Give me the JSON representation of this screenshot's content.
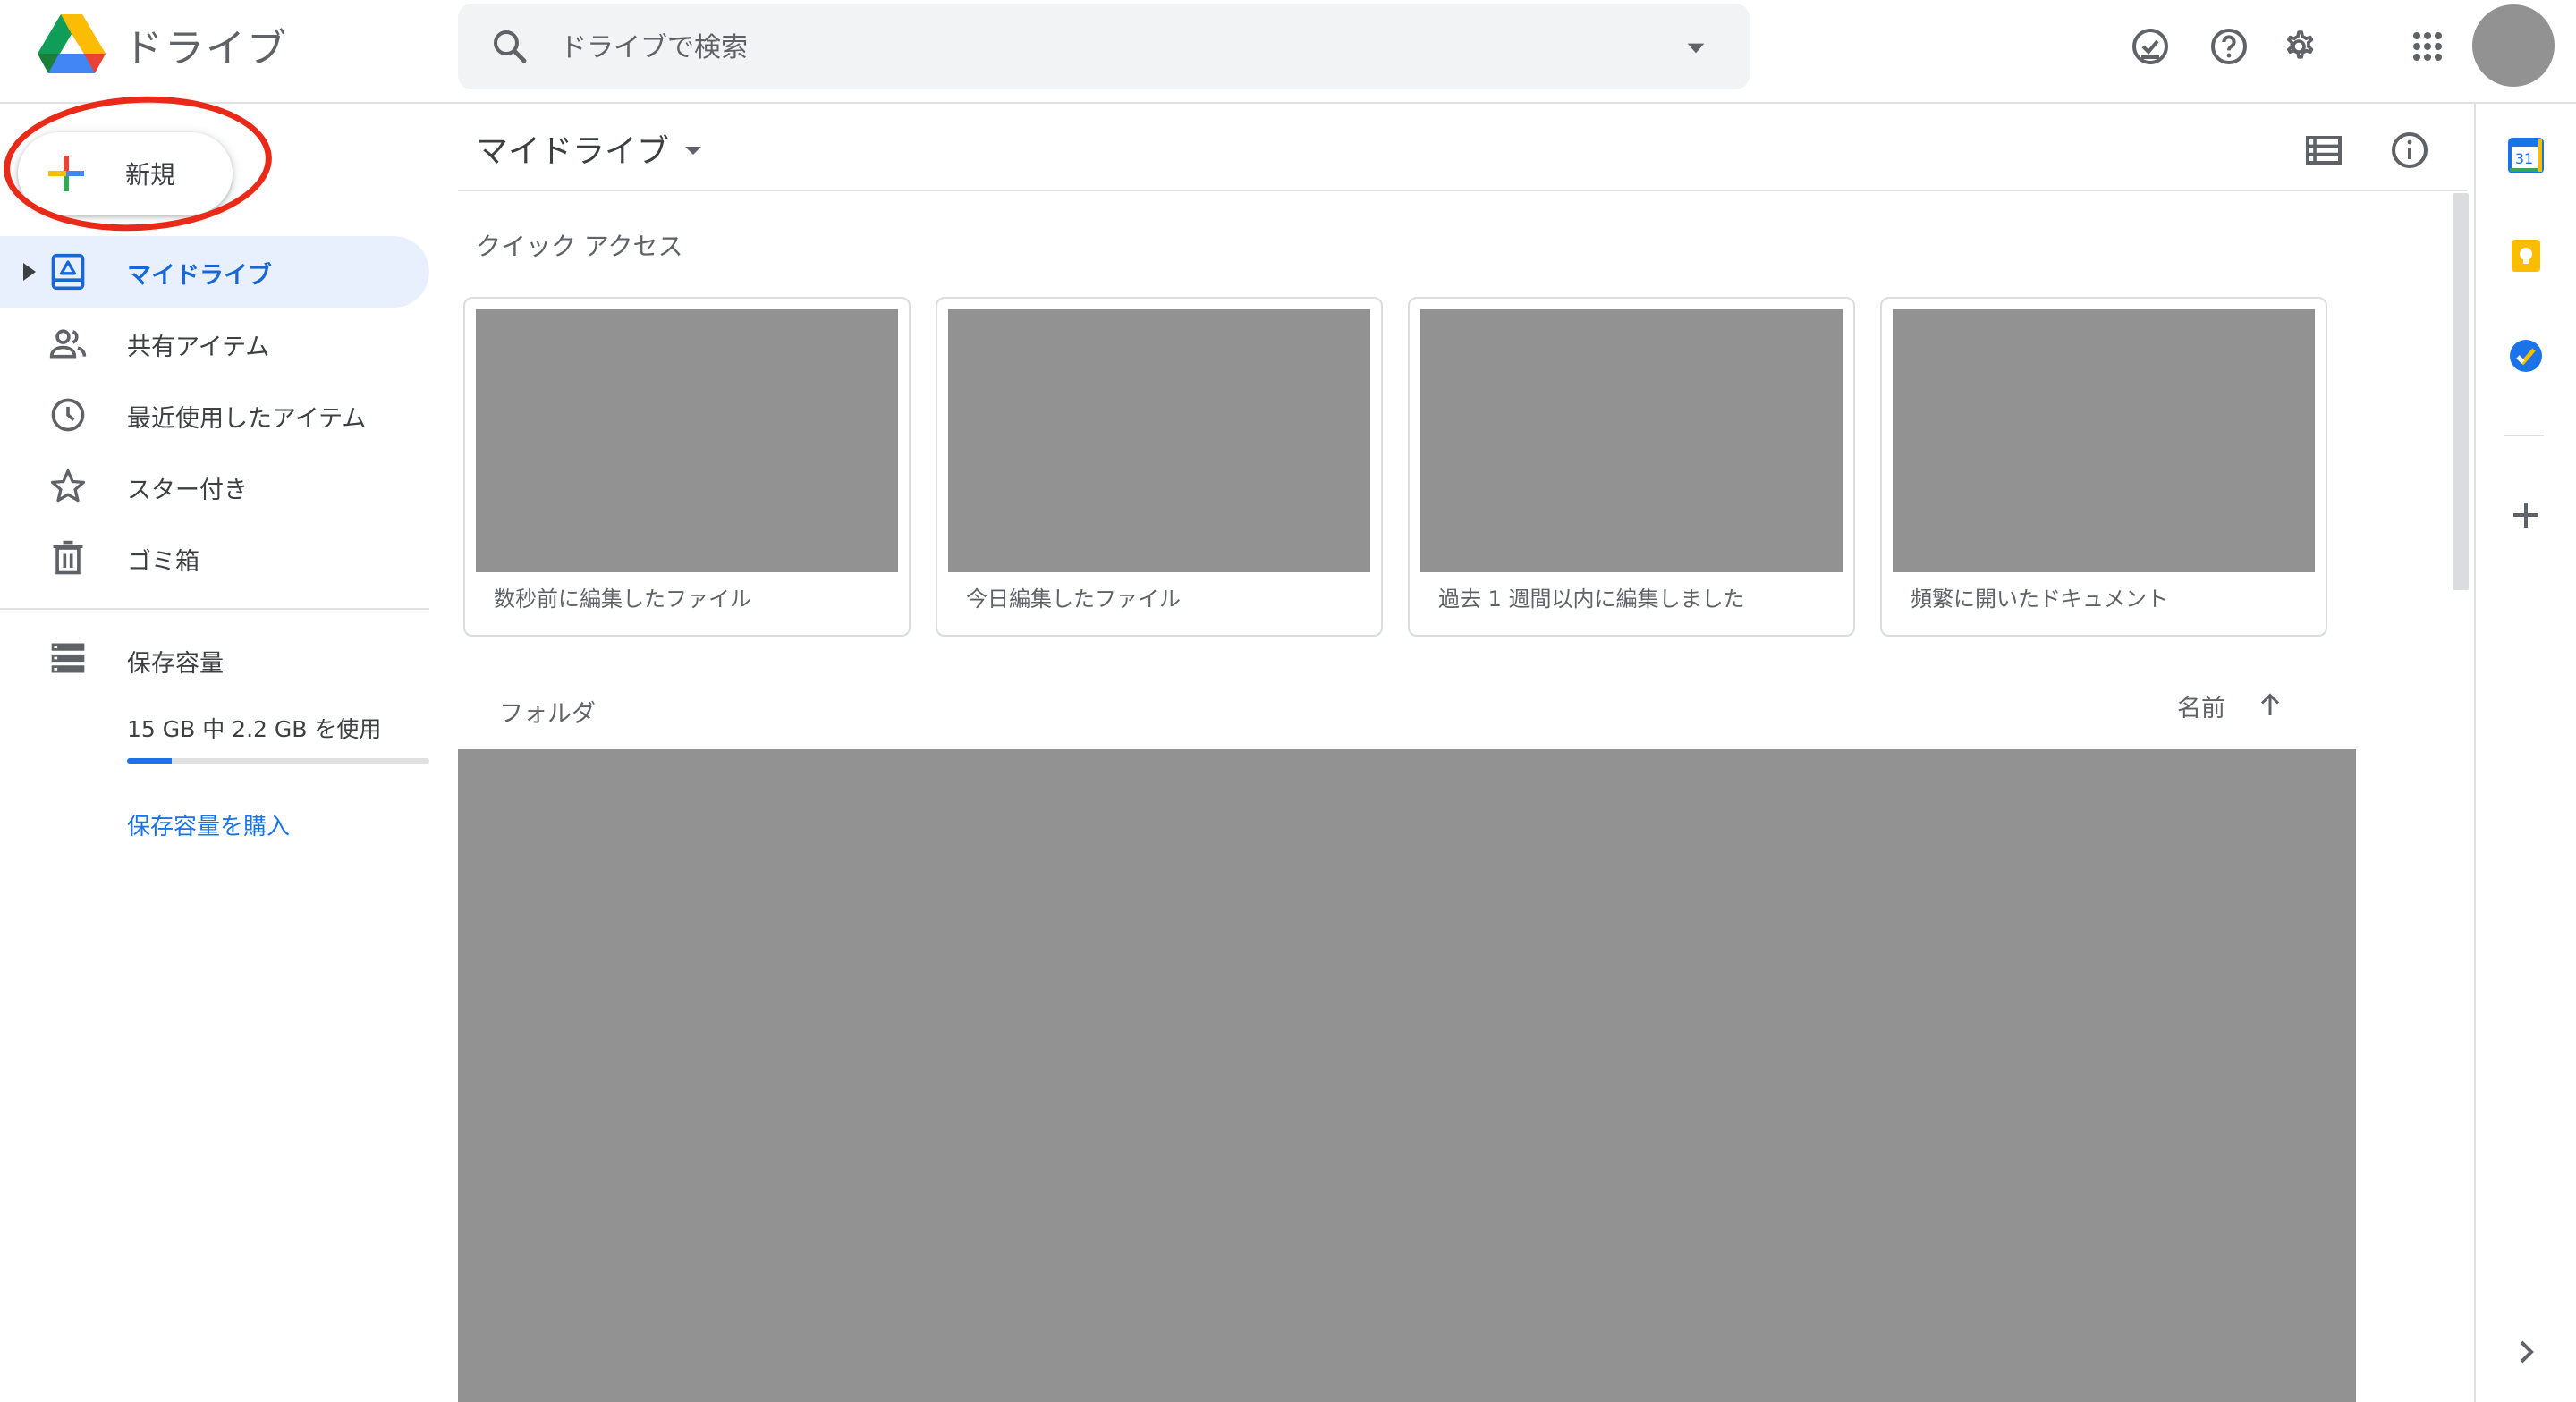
{
  "header": {
    "app_title": "ドライブ",
    "search_placeholder": "ドライブで検索",
    "icons": [
      "drive-logo",
      "search-icon",
      "search-options-caret",
      "offline-ready-icon",
      "help-icon",
      "settings-icon",
      "apps-grid-icon",
      "account-avatar"
    ]
  },
  "sidebar": {
    "new_button": "新規",
    "items": [
      {
        "label": "マイドライブ",
        "icon": "my-drive-icon",
        "active": true
      },
      {
        "label": "共有アイテム",
        "icon": "shared-people-icon",
        "active": false
      },
      {
        "label": "最近使用したアイテム",
        "icon": "clock-icon",
        "active": false
      },
      {
        "label": "スター付き",
        "icon": "star-icon",
        "active": false
      },
      {
        "label": "ゴミ箱",
        "icon": "trash-icon",
        "active": false
      }
    ],
    "storage": {
      "label": "保存容量",
      "usage": "15 GB 中 2.2 GB を使用",
      "used_fraction": 0.147,
      "buy_link": "保存容量を購入"
    }
  },
  "main": {
    "title": "マイドライブ",
    "quick_access": {
      "heading": "クイック アクセス",
      "cards": [
        {
          "caption": "数秒前に編集したファイル"
        },
        {
          "caption": "今日編集したファイル"
        },
        {
          "caption": "過去 1 週間以内に編集しました"
        },
        {
          "caption": "頻繁に開いたドキュメント"
        }
      ]
    },
    "folders": {
      "heading": "フォルダ",
      "sort_label": "名前"
    },
    "toolbar_icons": [
      "list-view-icon",
      "info-icon"
    ]
  },
  "right_rail": {
    "icons": [
      "calendar-icon",
      "keep-icon",
      "tasks-icon",
      "add-addon-icon",
      "expand-panel-icon"
    ],
    "calendar_day": "31"
  },
  "colors": {
    "accent_blue": "#1a73e8",
    "active_bg": "#e8f0fe",
    "placeholder_gray": "#929292",
    "highlight_red": "#ea2a18"
  }
}
